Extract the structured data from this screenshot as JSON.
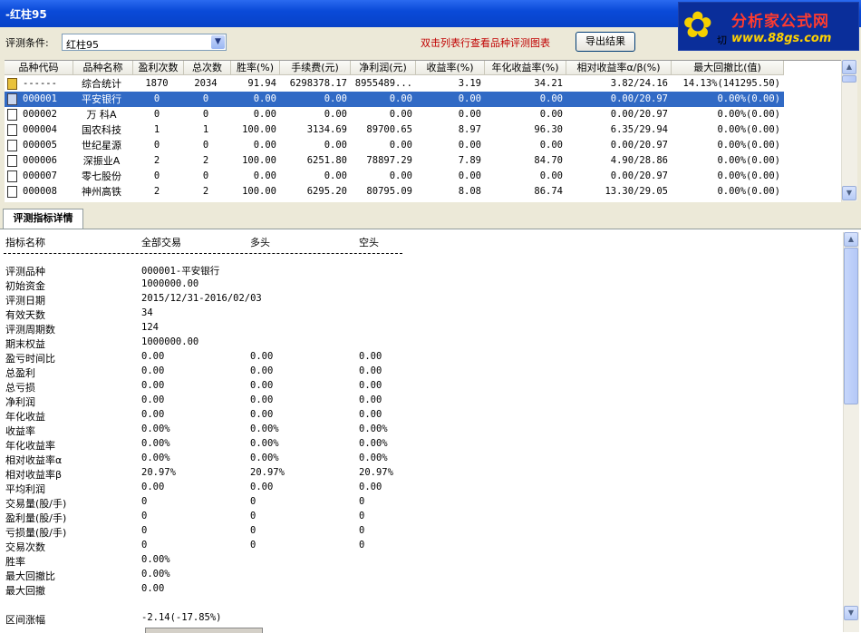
{
  "window": {
    "title": "-红柱95"
  },
  "logo": {
    "line1": "分析家公式网",
    "line2": "www.88gs.com"
  },
  "toolbar": {
    "condition_label": "评测条件:",
    "condition_value": "红柱95",
    "hint": "双击列表行查看品种评测图表",
    "export_label": "导出结果",
    "right_label": "切"
  },
  "table": {
    "headers": [
      "品种代码",
      "品种名称",
      "盈利次数",
      "总次数",
      "胜率(%)",
      "手续费(元)",
      "净利润(元)",
      "收益率(%)",
      "年化收益率(%)",
      "相对收益率α/β(%)",
      "最大回撤比(值)"
    ],
    "rows": [
      {
        "code": "------",
        "name": "综合统计",
        "win": "1870",
        "total": "2034",
        "rate": "91.94",
        "fee": "6298378.17",
        "profit": "8955489...",
        "ret": "3.19",
        "annual": "34.21",
        "rel": "3.82/24.16",
        "dd": "14.13%(141295.50)",
        "icon": "sum"
      },
      {
        "code": "000001",
        "name": "平安银行",
        "win": "0",
        "total": "0",
        "rate": "0.00",
        "fee": "0.00",
        "profit": "0.00",
        "ret": "0.00",
        "annual": "0.00",
        "rel": "0.00/20.97",
        "dd": "0.00%(0.00)",
        "icon": "sel"
      },
      {
        "code": "000002",
        "name": "万  科A",
        "win": "0",
        "total": "0",
        "rate": "0.00",
        "fee": "0.00",
        "profit": "0.00",
        "ret": "0.00",
        "annual": "0.00",
        "rel": "0.00/20.97",
        "dd": "0.00%(0.00)",
        "icon": "file"
      },
      {
        "code": "000004",
        "name": "国农科技",
        "win": "1",
        "total": "1",
        "rate": "100.00",
        "fee": "3134.69",
        "profit": "89700.65",
        "ret": "8.97",
        "annual": "96.30",
        "rel": "6.35/29.94",
        "dd": "0.00%(0.00)",
        "icon": "file"
      },
      {
        "code": "000005",
        "name": "世纪星源",
        "win": "0",
        "total": "0",
        "rate": "0.00",
        "fee": "0.00",
        "profit": "0.00",
        "ret": "0.00",
        "annual": "0.00",
        "rel": "0.00/20.97",
        "dd": "0.00%(0.00)",
        "icon": "file"
      },
      {
        "code": "000006",
        "name": "深振业A",
        "win": "2",
        "total": "2",
        "rate": "100.00",
        "fee": "6251.80",
        "profit": "78897.29",
        "ret": "7.89",
        "annual": "84.70",
        "rel": "4.90/28.86",
        "dd": "0.00%(0.00)",
        "icon": "file"
      },
      {
        "code": "000007",
        "name": "零七股份",
        "win": "0",
        "total": "0",
        "rate": "0.00",
        "fee": "0.00",
        "profit": "0.00",
        "ret": "0.00",
        "annual": "0.00",
        "rel": "0.00/20.97",
        "dd": "0.00%(0.00)",
        "icon": "file"
      },
      {
        "code": "000008",
        "name": "神州高铁",
        "win": "2",
        "total": "2",
        "rate": "100.00",
        "fee": "6295.20",
        "profit": "80795.09",
        "ret": "8.08",
        "annual": "86.74",
        "rel": "13.30/29.05",
        "dd": "0.00%(0.00)",
        "icon": "file"
      }
    ],
    "selected_index": 1
  },
  "detail_tab": {
    "label": "评测指标详情"
  },
  "detail": {
    "header": [
      "指标名称",
      "全部交易",
      "多头",
      "空头"
    ],
    "separator": "--------------------------------------------------------------------------------",
    "rows": [
      {
        "label": "评测品种",
        "all": "000001-平安银行",
        "long": "",
        "short": ""
      },
      {
        "label": "初始资金",
        "all": "1000000.00",
        "long": "",
        "short": ""
      },
      {
        "label": "评测日期",
        "all": "2015/12/31-2016/02/03",
        "long": "",
        "short": ""
      },
      {
        "label": "有效天数",
        "all": "34",
        "long": "",
        "short": ""
      },
      {
        "label": "评测周期数",
        "all": "124",
        "long": "",
        "short": ""
      },
      {
        "label": "期末权益",
        "all": "1000000.00",
        "long": "",
        "short": ""
      },
      {
        "label": "盈亏时间比",
        "all": "0.00",
        "long": "0.00",
        "short": "0.00"
      },
      {
        "label": "总盈利",
        "all": "0.00",
        "long": "0.00",
        "short": "0.00"
      },
      {
        "label": "总亏损",
        "all": "0.00",
        "long": "0.00",
        "short": "0.00"
      },
      {
        "label": "净利润",
        "all": "0.00",
        "long": "0.00",
        "short": "0.00"
      },
      {
        "label": "年化收益",
        "all": "0.00",
        "long": "0.00",
        "short": "0.00"
      },
      {
        "label": "收益率",
        "all": "0.00%",
        "long": "0.00%",
        "short": "0.00%"
      },
      {
        "label": "年化收益率",
        "all": "0.00%",
        "long": "0.00%",
        "short": "0.00%"
      },
      {
        "label": "相对收益率α",
        "all": "0.00%",
        "long": " 0.00%",
        "short": " 0.00%"
      },
      {
        "label": "相对收益率β",
        "all": "20.97%",
        "long": " 20.97%",
        "short": " 20.97%"
      },
      {
        "label": "平均利润",
        "all": "0.00",
        "long": "0.00",
        "short": "0.00"
      },
      {
        "label": "交易量(股/手)",
        "all": "0",
        "long": "0",
        "short": "0"
      },
      {
        "label": "盈利量(股/手)",
        "all": "0",
        "long": "0",
        "short": "0"
      },
      {
        "label": "亏损量(股/手)",
        "all": "0",
        "long": "0",
        "short": "0"
      },
      {
        "label": "交易次数",
        "all": "0",
        "long": "0",
        "short": "0"
      },
      {
        "label": "胜率",
        "all": "0.00%",
        "long": "",
        "short": ""
      },
      {
        "label": "最大回撤比",
        "all": "0.00%",
        "long": "",
        "short": ""
      },
      {
        "label": "最大回撤",
        "all": "0.00",
        "long": "",
        "short": ""
      },
      {
        "label": "",
        "all": "",
        "long": "",
        "short": ""
      },
      {
        "label": "区间涨幅",
        "all": "-2.14(-17.85%)",
        "long": "",
        "short": ""
      }
    ]
  }
}
